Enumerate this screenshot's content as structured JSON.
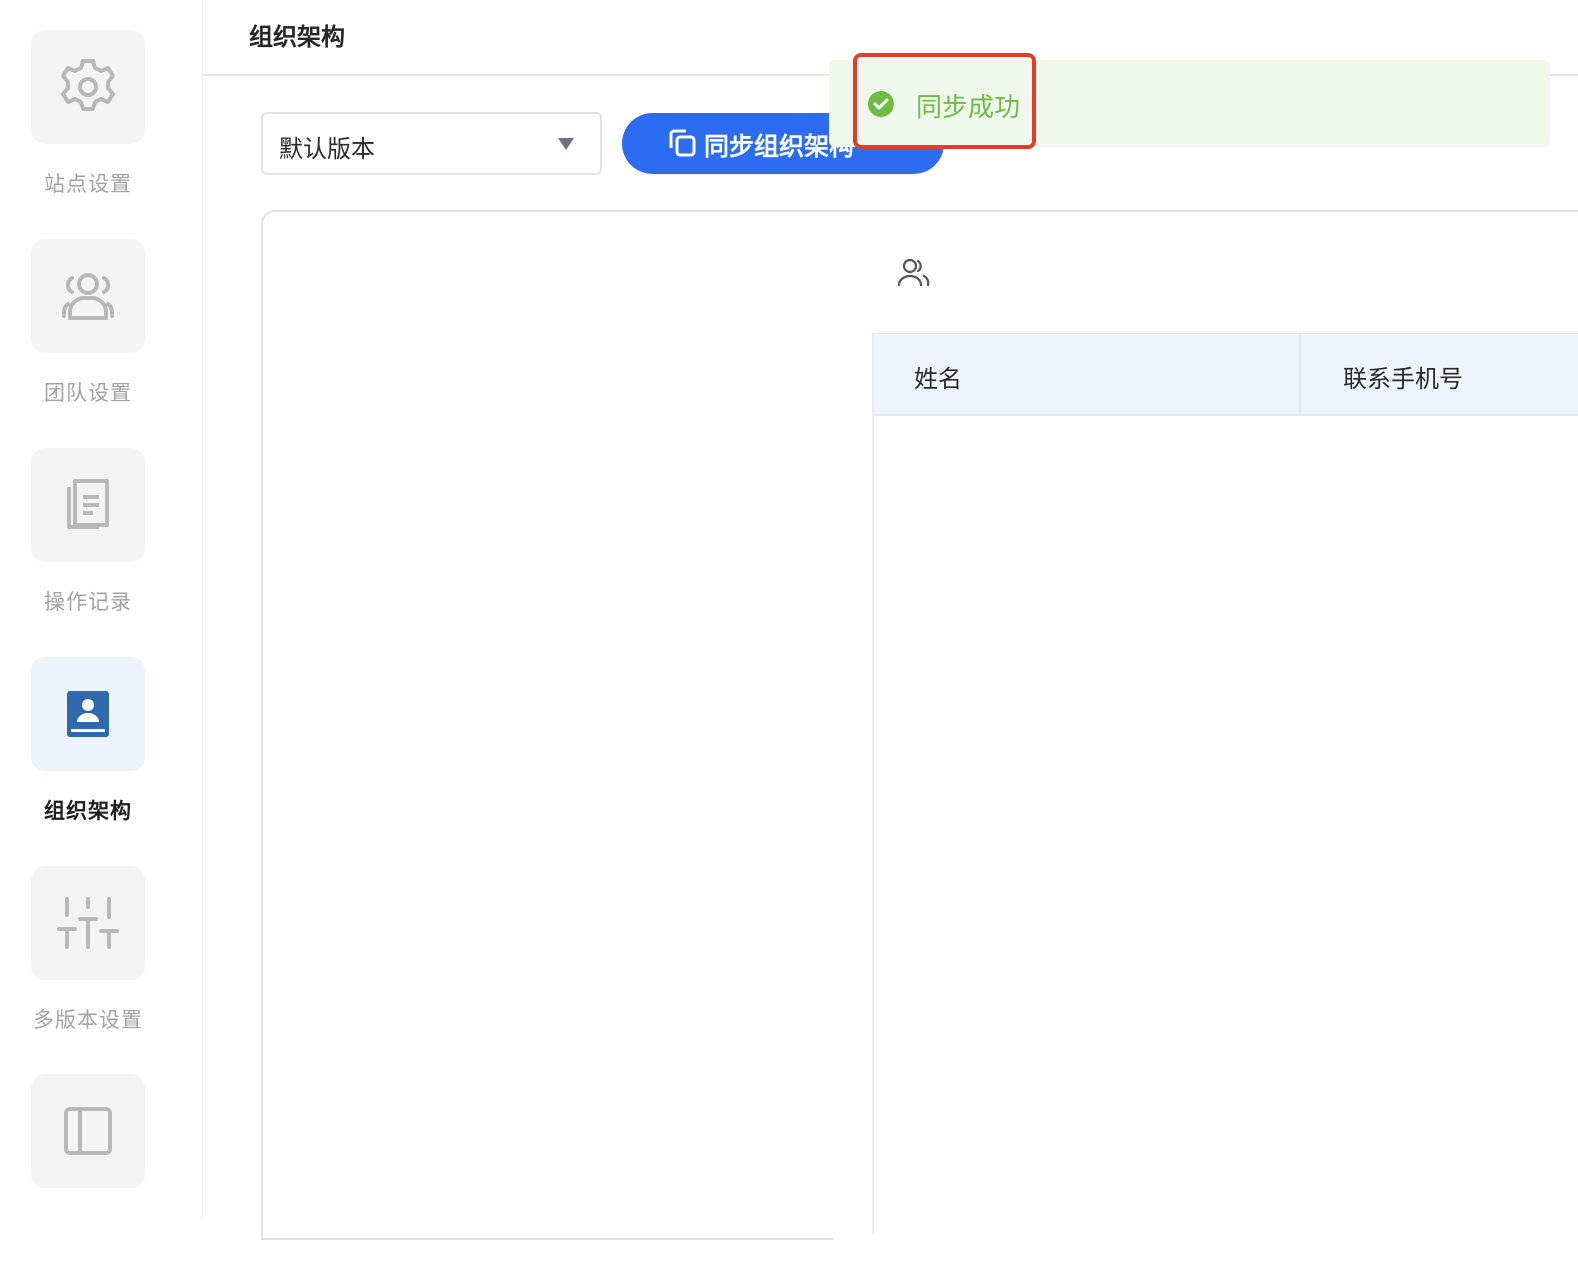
{
  "sidebar": {
    "items": [
      {
        "label": "站点设置",
        "icon": "gear-icon",
        "active": false
      },
      {
        "label": "团队设置",
        "icon": "team-icon",
        "active": false
      },
      {
        "label": "操作记录",
        "icon": "document-icon",
        "active": false
      },
      {
        "label": "组织架构",
        "icon": "contact-book-icon",
        "active": true
      },
      {
        "label": "多版本设置",
        "icon": "sliders-icon",
        "active": false
      },
      {
        "label": "",
        "icon": "sidebar-layout-icon",
        "active": false
      }
    ]
  },
  "header": {
    "title": "组织架构"
  },
  "toolbar": {
    "version_value": "默认版本",
    "sync_label": "同步组织架构"
  },
  "table": {
    "columns": [
      "姓名",
      "联系手机号"
    ]
  },
  "toast": {
    "message": "同步成功",
    "type": "success"
  },
  "colors": {
    "primary": "#2c6cf0",
    "success": "#6dbd45",
    "highlight": "#e43b2a",
    "active_text": "#1f1f1f",
    "muted_text": "#a3a3a3"
  }
}
